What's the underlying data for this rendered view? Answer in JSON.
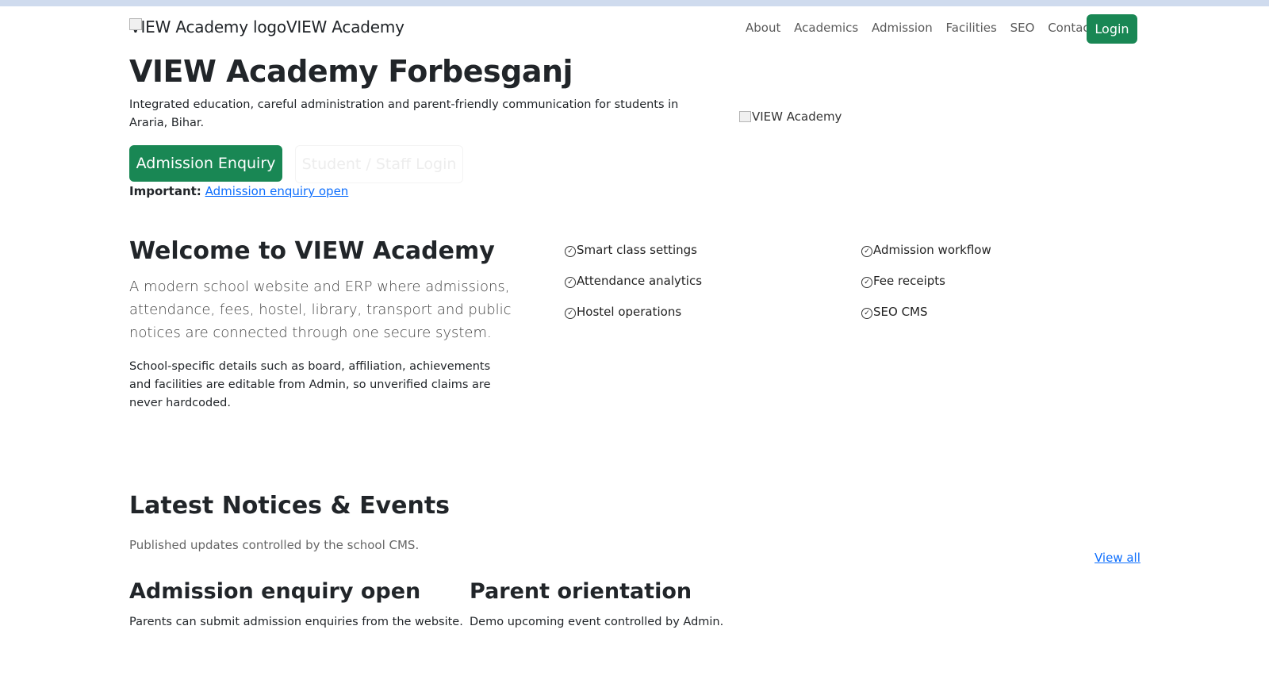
{
  "header": {
    "brand_logo_alt": "VIEW Academy logo",
    "brand_name": "VIEW Academy",
    "nav": [
      "About",
      "Academics",
      "Admission",
      "Facilities",
      "SEO",
      "Contact"
    ],
    "login_label": "Login"
  },
  "hero": {
    "title": "VIEW Academy Forbesganj",
    "lead": "Integrated education, careful administration and parent-friendly communication for students in Araria, Bihar.",
    "enquiry_button": "Admission Enquiry",
    "login_button": "Student / Staff Login",
    "important_label": "Important:",
    "important_link": "Admission enquiry open",
    "image_alt": "VIEW Academy"
  },
  "welcome": {
    "title": "Welcome to VIEW Academy",
    "lead": "A modern school website and ERP where admissions, attendance, fees, hostel, library, transport and public notices are connected through one secure system.",
    "note": "School-specific details such as board, affiliation, achievements and facilities are editable from Admin, so unverified claims are never hardcoded.",
    "features": [
      "Smart class settings",
      "Admission workflow",
      "Attendance analytics",
      "Fee receipts",
      "Hostel operations",
      "SEO CMS"
    ]
  },
  "notices": {
    "title": "Latest Notices & Events",
    "subtitle": "Published updates controlled by the school CMS.",
    "view_all": "View all",
    "items": [
      {
        "title": "Admission enquiry open",
        "text": "Parents can submit admission enquiries from the website."
      },
      {
        "title": "Parent orientation",
        "text": "Demo upcoming event controlled by Admin."
      }
    ]
  },
  "colors": {
    "brand_green": "#198754",
    "link_blue": "#0d6efd"
  }
}
